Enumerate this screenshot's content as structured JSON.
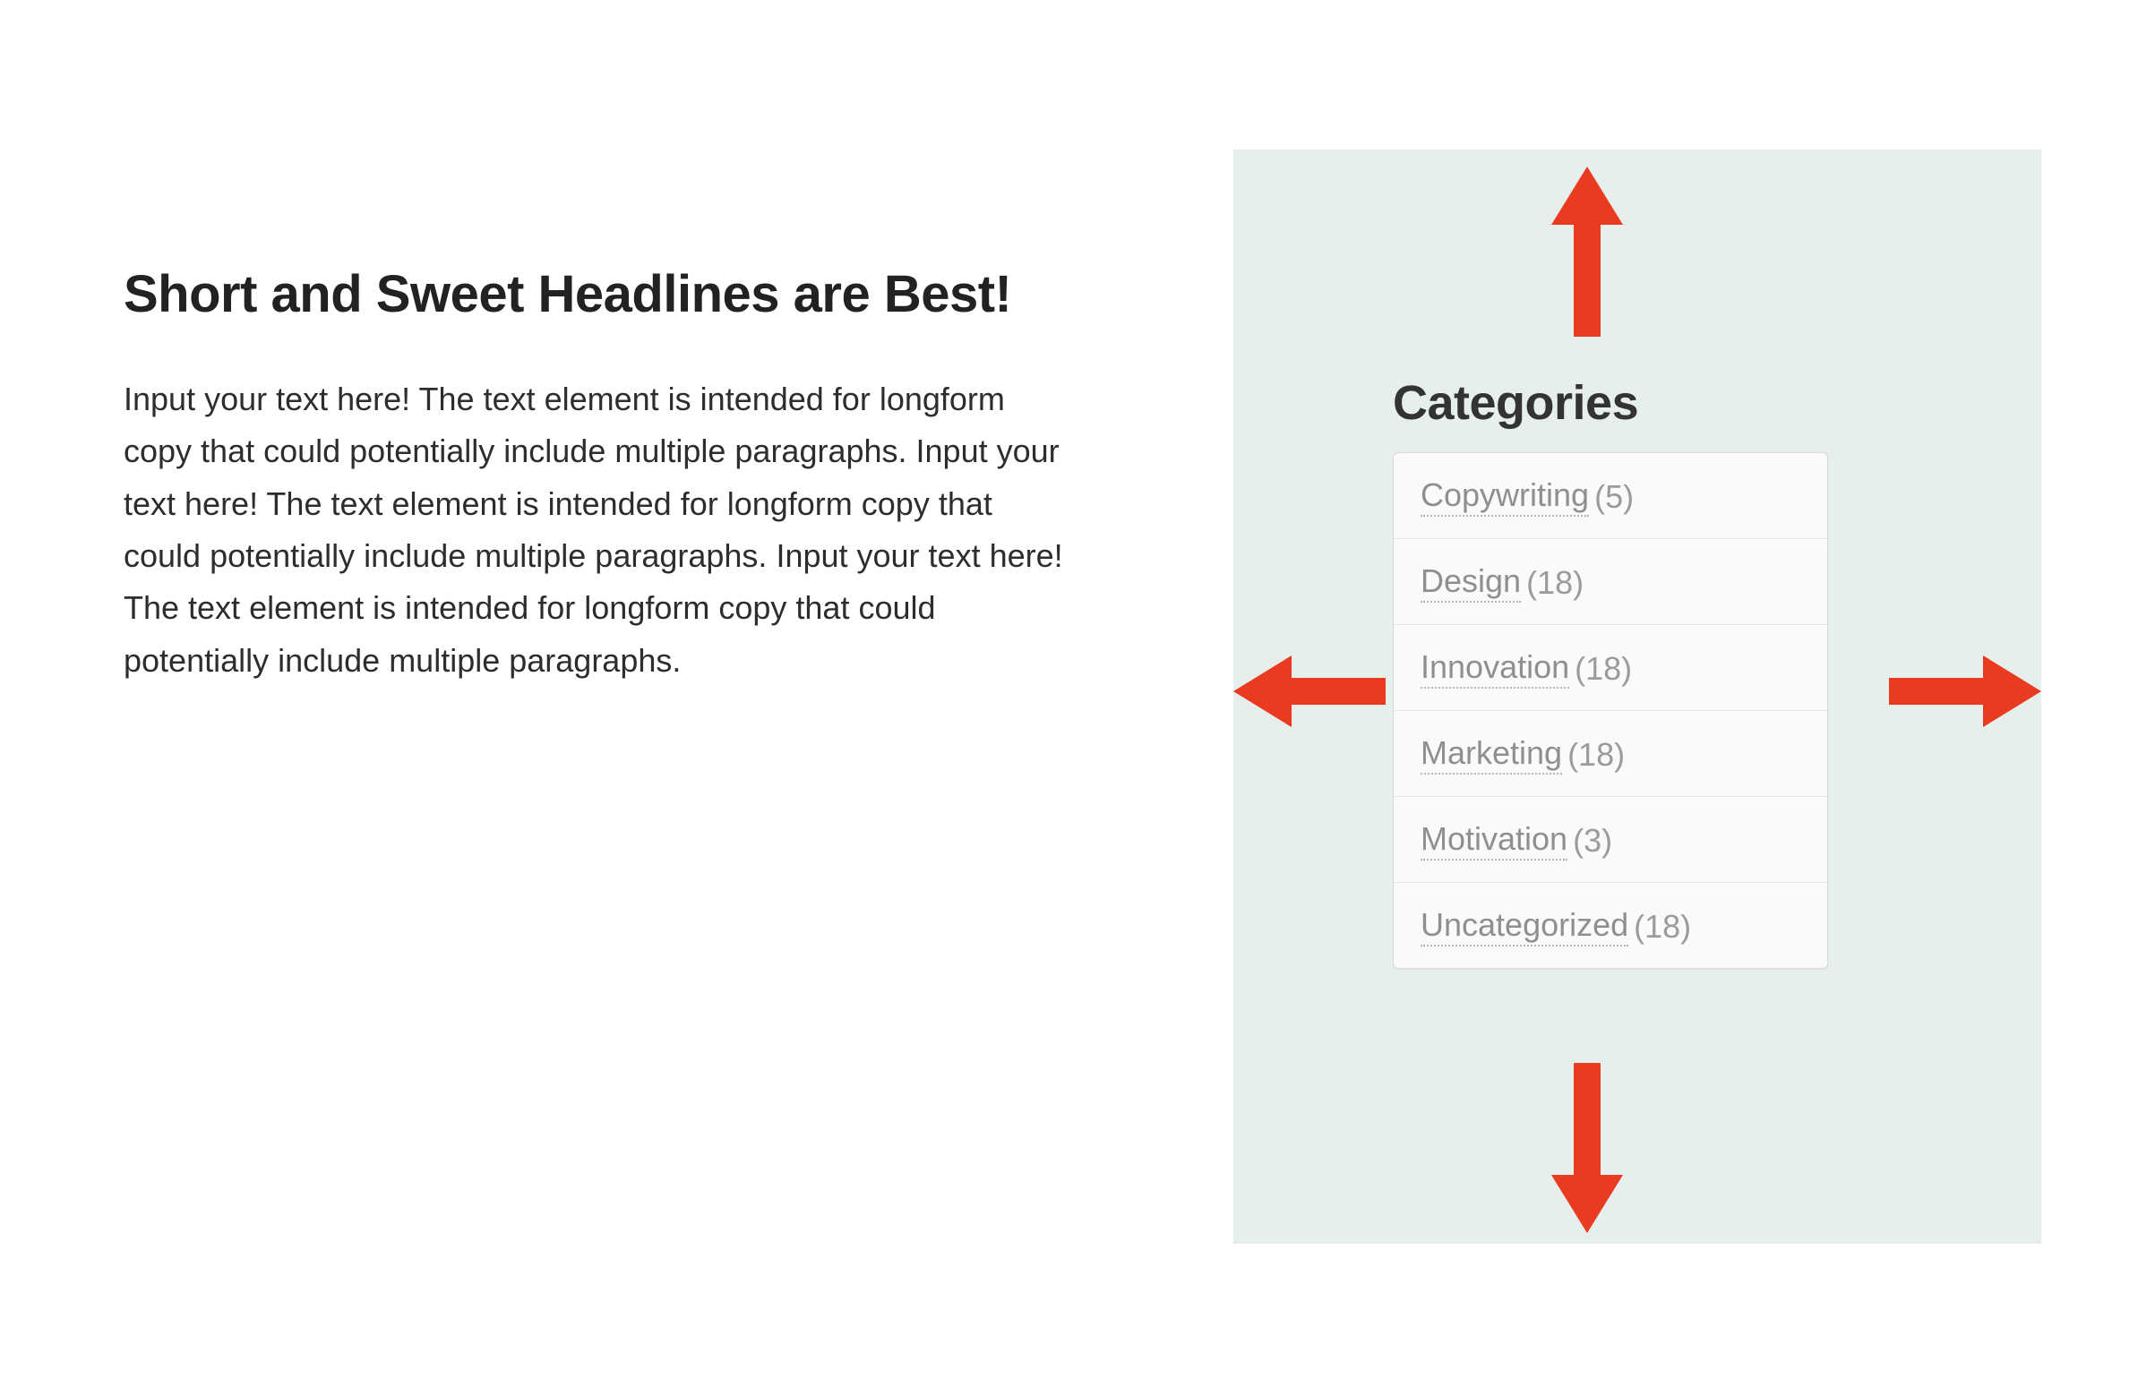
{
  "article": {
    "headline": "Short and Sweet Headlines are Best!",
    "body": "Input your text here! The text element is intended for longform copy that could potentially include multiple paragraphs. Input your text here! The text element is intended for longform copy that could potentially include multiple paragraphs. Input your text here! The text element is intended for longform copy that could potentially include multiple paragraphs."
  },
  "sidebar": {
    "widget_title": "Categories",
    "categories": [
      {
        "name": "Copywriting",
        "count_text": "(5)"
      },
      {
        "name": "Design",
        "count_text": "(18)"
      },
      {
        "name": "Innovation",
        "count_text": "(18)"
      },
      {
        "name": "Marketing",
        "count_text": "(18)"
      },
      {
        "name": "Motivation",
        "count_text": "(3)"
      },
      {
        "name": "Uncategorized",
        "count_text": "(18)"
      }
    ]
  },
  "annotation": {
    "arrow_color": "#ea3a1f"
  }
}
